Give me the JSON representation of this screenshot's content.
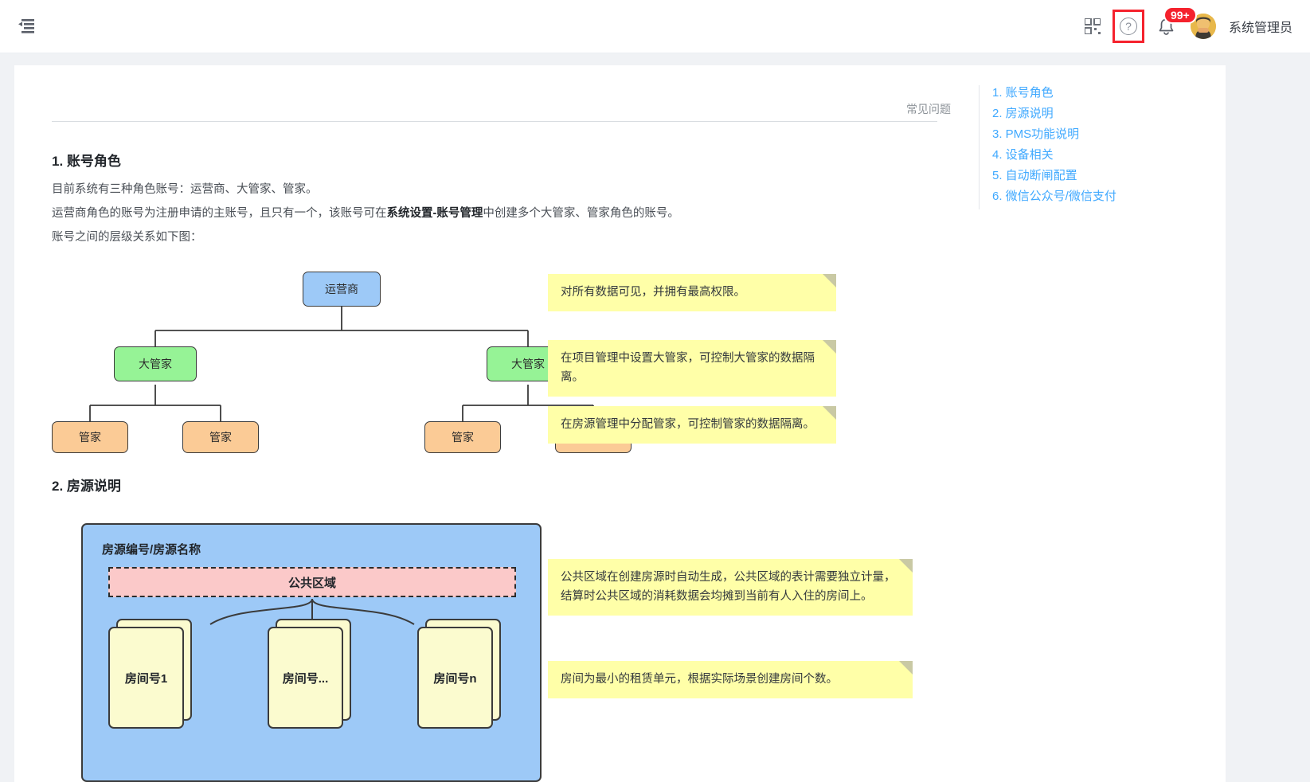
{
  "topbar": {
    "collapse_icon": "menu-fold-icon",
    "qr_icon": "qrcode-icon",
    "help_icon": "question-circle-icon",
    "help_glyph": "?",
    "bell_icon": "bell-icon",
    "bell_glyph": "☐",
    "badge_count": "99+",
    "username": "系统管理员",
    "accent_red": "#f5222d"
  },
  "page": {
    "faq_label": "常见问题"
  },
  "toc": {
    "items": [
      {
        "label": "1. 账号角色"
      },
      {
        "label": "2. 房源说明"
      },
      {
        "label": "3. PMS功能说明"
      },
      {
        "label": "4. 设备相关"
      },
      {
        "label": "5. 自动断闸配置"
      },
      {
        "label": "6. 微信公众号/微信支付"
      }
    ],
    "link_color": "#40a9ff"
  },
  "section1": {
    "heading": "1. 账号角色",
    "p1": "目前系统有三种角色账号：运营商、大管家、管家。",
    "p2_a": "运营商角色的账号为注册申请的主账号，且只有一个，该账号可在",
    "p2_b": "系统设置-账号管理",
    "p2_c": "中创建多个大管家、管家角色的账号。",
    "p3": "账号之间的层级关系如下图："
  },
  "orgchart": {
    "root": {
      "label": "运营商",
      "color": "#9dc9f7"
    },
    "managers": [
      {
        "label": "大管家",
        "color": "#96f396"
      },
      {
        "label": "大管家",
        "color": "#96f396"
      }
    ],
    "stewards": [
      {
        "label": "管家",
        "color": "#fbcb96"
      },
      {
        "label": "管家",
        "color": "#fbcb96"
      },
      {
        "label": "管家",
        "color": "#fbcb96"
      },
      {
        "label": "管家",
        "color": "#fbcb96"
      }
    ],
    "notes": [
      {
        "text": "对所有数据可见，并拥有最高权限。"
      },
      {
        "text": "在项目管理中设置大管家，可控制大管家的数据隔离。"
      },
      {
        "text": "在房源管理中分配管家，可控制管家的数据隔离。"
      }
    ]
  },
  "section2": {
    "heading": "2. 房源说明",
    "house_title": "房源编号/房源名称",
    "public_area": "公共区域",
    "rooms": [
      {
        "label": "房间号1"
      },
      {
        "label": "房间号..."
      },
      {
        "label": "房间号n"
      }
    ],
    "notes": [
      {
        "line1": "公共区域在创建房源时自动生成，公共区域的表计需要独立计量，",
        "line2": "结算时公共区域的消耗数据会均摊到当前有人入住的房间上。"
      },
      {
        "line1": "房间为最小的租赁单元，根据实际场景创建房间个数。",
        "line2": ""
      }
    ]
  }
}
